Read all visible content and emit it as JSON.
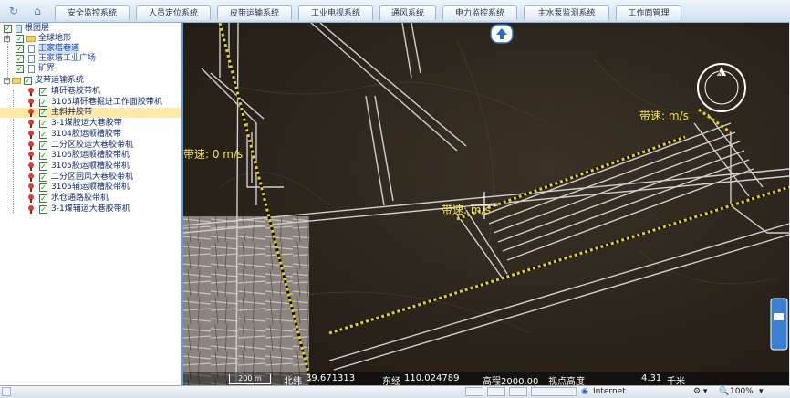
{
  "nav": {
    "tabs": [
      "安全监控系统",
      "人员定位系统",
      "皮带运输系统",
      "工业电视系统",
      "通风系统",
      "电力监控系统",
      "主水泵监测系统",
      "工作面管理"
    ]
  },
  "tree": {
    "root": "根图层",
    "terrain": "全球地形",
    "layer_roadway": "王家塔巷道",
    "layer_square": "王家塔工业广场",
    "layer_boundary": "矿界",
    "belt_system": "皮带运输系统",
    "belts": [
      "填矸巷胶带机",
      "3105填矸巷掘进工作面胶带机",
      "主斜井胶带",
      "3-1煤胶运大巷胶带",
      "3104胶运顺槽胶带",
      "二分区胶运大巷胶带机",
      "3106胶运顺槽胶带机",
      "3105胶运顺槽胶带机",
      "二分区回风大巷胶带机",
      "3105辅运顺槽胶带机",
      "水仓通路胶带机",
      "3-1煤辅运大巷胶带机"
    ],
    "selected_index": 2
  },
  "map": {
    "speed_left": "带速: 0 m/s",
    "speed_center": "带速: m/s",
    "speed_right": "带速:  m/s",
    "compass_label": "N"
  },
  "status": {
    "scale": "200 m",
    "lat_label": "北纬",
    "lat": "39.671313",
    "lon_label": "东经",
    "lon": "110.024789",
    "elev": "高程2000.00",
    "view_label": "视点高度",
    "view_height": "4.31",
    "view_unit": "千米"
  },
  "ie": {
    "zone": "Internet",
    "zoom": "100%"
  }
}
